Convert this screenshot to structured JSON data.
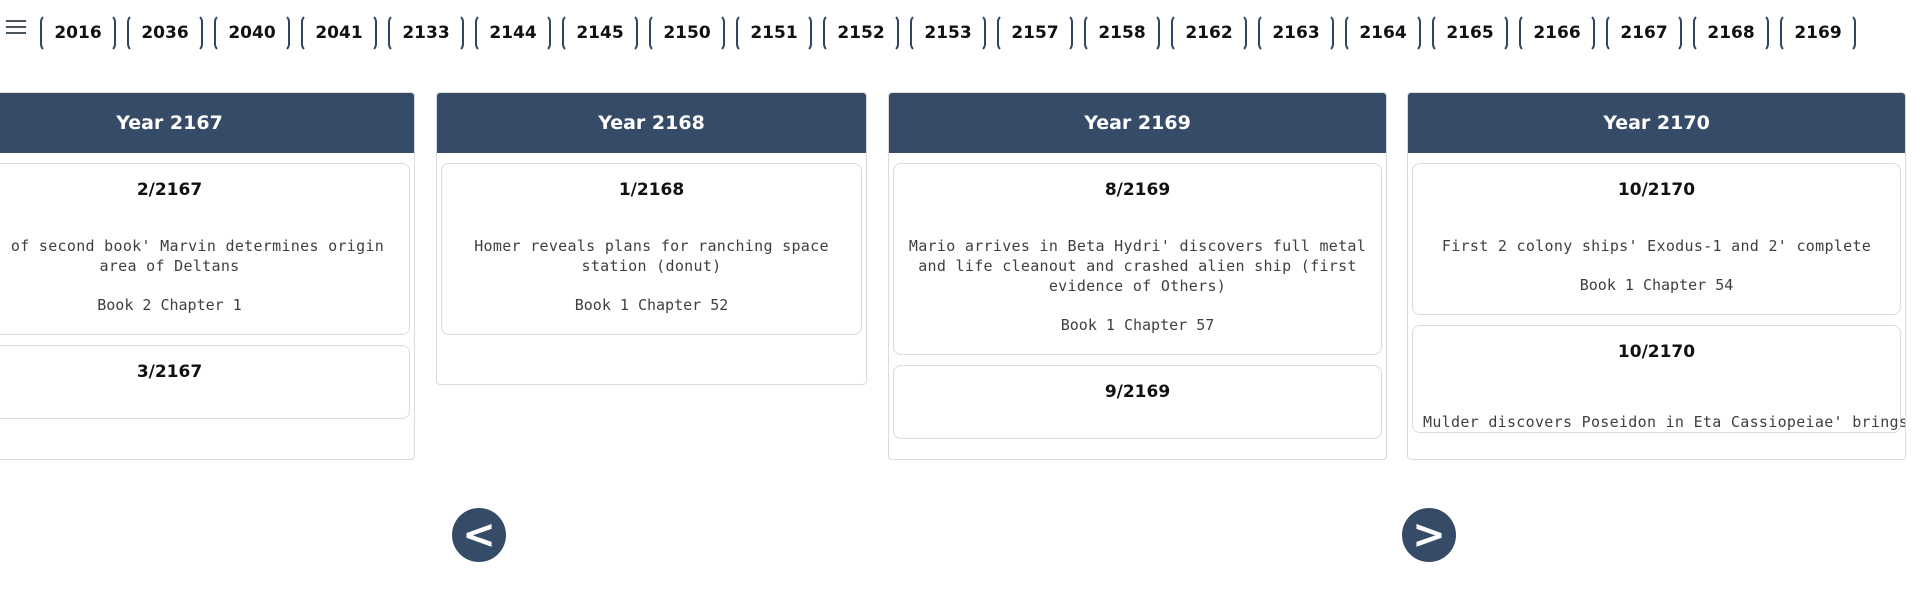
{
  "menu": {
    "icon": "hamburger-menu-icon"
  },
  "year_nav": [
    "2016",
    "2036",
    "2040",
    "2041",
    "2133",
    "2144",
    "2145",
    "2150",
    "2151",
    "2152",
    "2153",
    "2157",
    "2158",
    "2162",
    "2163",
    "2164",
    "2165",
    "2166",
    "2167",
    "2168",
    "2169"
  ],
  "columns": [
    {
      "header": "Year 2167",
      "events": [
        {
          "date": "2/2167",
          "desc": "Start of second book' Marvin determines origin area of Deltans",
          "ref": "Book 2 Chapter 1"
        },
        {
          "date": "3/2167",
          "desc": "",
          "ref": ""
        }
      ]
    },
    {
      "header": "Year 2168",
      "events": [
        {
          "date": "1/2168",
          "desc": "Homer reveals plans for ranching space station (donut)",
          "ref": "Book 1 Chapter 52"
        }
      ]
    },
    {
      "header": "Year 2169",
      "events": [
        {
          "date": "8/2169",
          "desc": "Mario arrives in Beta Hydri' discovers full metal and life cleanout and crashed alien ship (first evidence of Others)",
          "ref": "Book 1 Chapter 57"
        },
        {
          "date": "9/2169",
          "desc": "",
          "ref": ""
        }
      ]
    },
    {
      "header": "Year 2170",
      "events": [
        {
          "date": "10/2170",
          "desc": "First 2 colony ships' Exodus-1 and 2' complete",
          "ref": "Book 1 Chapter 54"
        },
        {
          "date": "10/2170",
          "desc": "Mulder discovers Poseidon in Eta Cassiopeiae' brings Skinner",
          "ref": ""
        }
      ]
    }
  ],
  "nav": {
    "prev": "<",
    "next": ">"
  }
}
